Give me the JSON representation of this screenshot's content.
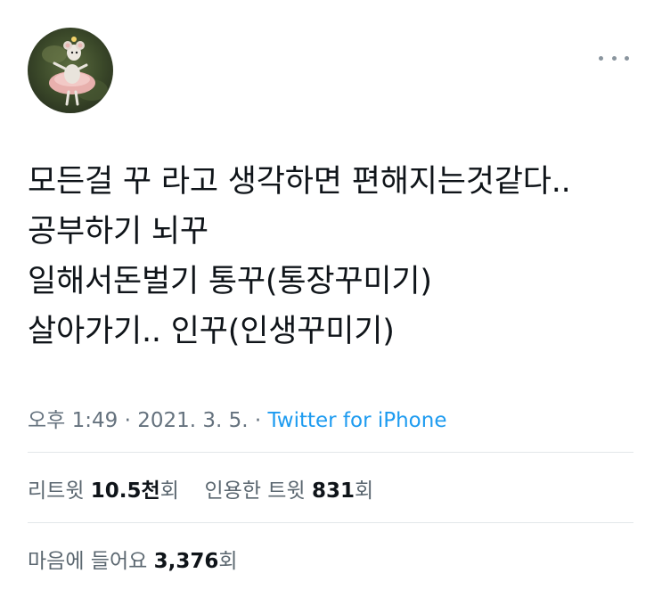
{
  "tweet": {
    "avatar_icon": "profile-photo-ballerina-mouse-icon",
    "more_icon": "more-options-icon",
    "lines": [
      "모든걸 꾸 라고 생각하면 편해지는것같다..",
      "공부하기 뇌꾸",
      "일해서돈벌기 통꾸(통장꾸미기)",
      "살아가기.. 인꾸(인생꾸미기)"
    ],
    "time": "오후 1:49",
    "sep1": " · ",
    "date": "2021. 3. 5.",
    "sep2": " · ",
    "source": "Twitter for iPhone"
  },
  "stats": {
    "retweets_label": "리트윗",
    "retweets_count": "10.5천",
    "retweets_unit": "회",
    "quotes_label": "인용한 트윗",
    "quotes_count": "831",
    "quotes_unit": "회",
    "likes_label": "마음에 들어요",
    "likes_count": "3,376",
    "likes_unit": "회"
  },
  "colors": {
    "text": "#0f1419",
    "secondary": "#65727e",
    "link": "#1d9bf0",
    "divider": "#e3e7ea"
  }
}
